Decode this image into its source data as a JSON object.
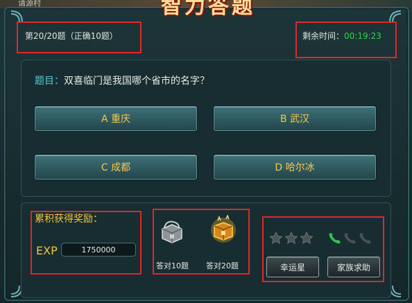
{
  "header": {
    "village": "请源村",
    "title": "智力答题",
    "progress": "第20/20题（正确10题）",
    "timer_label": "剩余时间：",
    "timer_value": "00:19:23"
  },
  "question": {
    "label": "题目：",
    "text": "双喜临门是我国哪个省市的名字？",
    "options": [
      "A 重庆",
      "B 武汉",
      "C 成都",
      "D 哈尔冰"
    ]
  },
  "rewards": {
    "title": "累积获得奖励：",
    "exp_label": "EXP",
    "exp_value": "1750000",
    "chests": [
      {
        "label": "答对10题",
        "icon": "silver-chest-icon"
      },
      {
        "label": "答对20题",
        "icon": "gold-chest-icon"
      }
    ]
  },
  "helpers": {
    "lucky_star_label": "幸运星",
    "family_help_label": "家族求助",
    "stars_active": 0,
    "stars_total": 3,
    "calls_active": 1,
    "calls_total": 3
  },
  "colors": {
    "accent_gold": "#f1c744",
    "timer_green": "#34d44a",
    "highlight_red": "#e02828"
  }
}
